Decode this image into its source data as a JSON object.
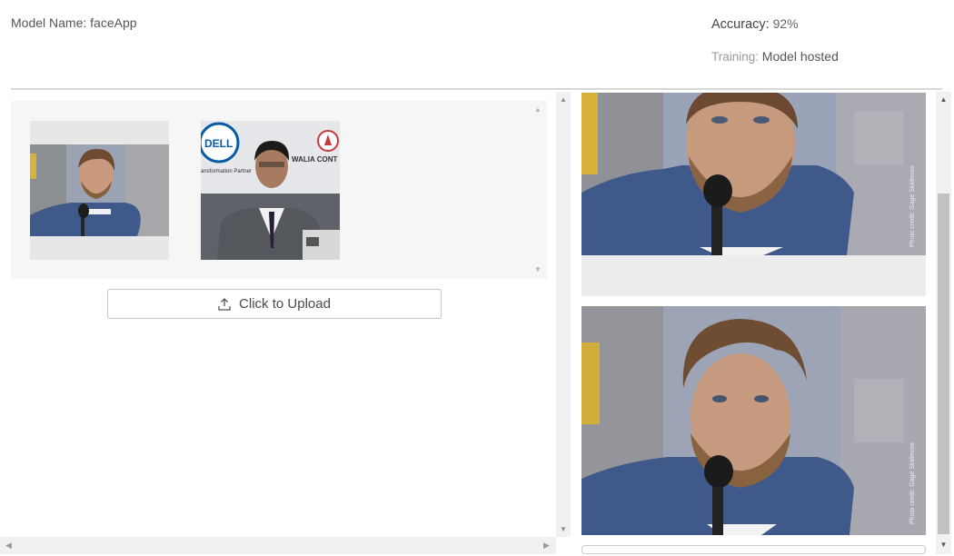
{
  "header": {
    "model_name": "Model Name: faceApp",
    "accuracy_label": "Accuracy:",
    "accuracy_value": "92%",
    "training_label": "Training:",
    "training_value": "Model hosted"
  },
  "upload": {
    "button_label": "Click to Upload",
    "icon": "upload-icon"
  },
  "thumbnails": [
    {
      "name": "bearded man at microphone"
    },
    {
      "name": "man at podium with Dell banner",
      "banner_left": "DELL",
      "banner_tagline": "ansformation Partner",
      "banner_right": "WALIA CONT"
    }
  ],
  "results": [
    {
      "credit": "Photo credit: Gage Skidmore"
    },
    {
      "credit": "Photo credit: Gage Skidmore"
    }
  ],
  "colors": {
    "panel_bg": "#f6f6f6",
    "scroll_track": "#f1f1f1",
    "scroll_thumb": "#c1c1c1",
    "jacket": "#3f5a8a"
  }
}
